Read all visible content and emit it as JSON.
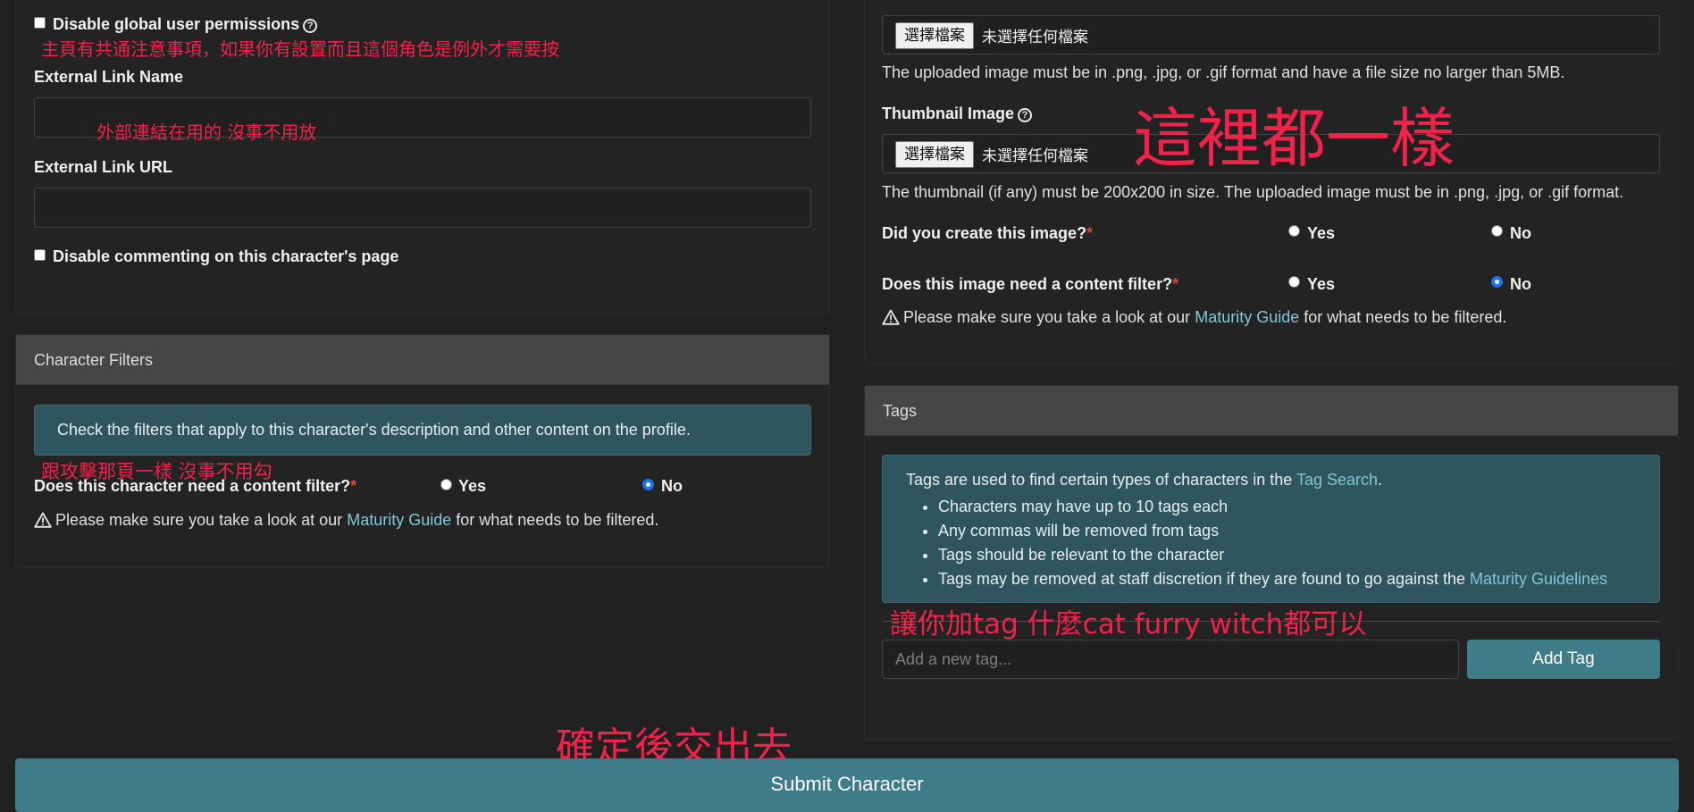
{
  "left": {
    "disable_perms_label": "Disable global user permissions",
    "anno_perms": "主頁有共通注意事項，如果你有設置而且這個角色是例外才需要按",
    "ext_name_label": "External Link Name",
    "anno_ext_name": "外部連結在用的 沒事不用放",
    "ext_url_label": "External Link URL",
    "disable_comment_label": "Disable commenting on this character's page"
  },
  "filters": {
    "header": "Character Filters",
    "info": "Check the filters that apply to this character's description and other content on the profile.",
    "anno": "跟攻擊那頁一樣 沒事不用勾",
    "question": "Does this character need a content filter?",
    "required_mark": "*",
    "yes": "Yes",
    "no": "No",
    "guide_before": "Please make sure you take a look at our",
    "guide_link": "Maturity Guide",
    "guide_after": "for what needs to be filtered."
  },
  "image": {
    "file_button": "選擇檔案",
    "file_status": "未選擇任何檔案",
    "image_help": "The uploaded image must be in .png, .jpg, or .gif format and have a file size no larger than 5MB.",
    "thumb_label": "Thumbnail Image",
    "thumb_file_button": "選擇檔案",
    "thumb_file_status": "未選擇任何檔案",
    "anno": "這裡都一樣",
    "thumb_help": "The thumbnail (if any) must be 200x200 in size. The uploaded image must be in .png, .jpg, or .gif format.",
    "created_q": "Did you create this image?",
    "filter_q": "Does this image need a content filter?",
    "required_mark": "*",
    "yes": "Yes",
    "no": "No",
    "guide_before": "Please make sure you take a look at our",
    "guide_link": "Maturity Guide",
    "guide_after": "for what needs to be filtered."
  },
  "tags": {
    "header": "Tags",
    "intro_before": "Tags are used to find certain types of characters in the",
    "intro_link": "Tag Search",
    "intro_after": ".",
    "items": [
      "Characters may have up to 10 tags each",
      "Any commas will be removed from tags",
      "Tags should be relevant to the character",
      "Tags may be removed at staff discretion if they are found to go against the"
    ],
    "item4_link": "Maturity Guidelines",
    "anno": "讓你加tag 什麼cat furry witch都可以",
    "input_placeholder": "Add a new tag...",
    "add_button": "Add Tag"
  },
  "submit": {
    "anno": "確定後交出去",
    "label": "Submit Character"
  },
  "colors": {
    "annotation": "#f0224a",
    "accent": "#3f7c8a",
    "link": "#7fc8d8",
    "info_bg": "#2f555f"
  }
}
